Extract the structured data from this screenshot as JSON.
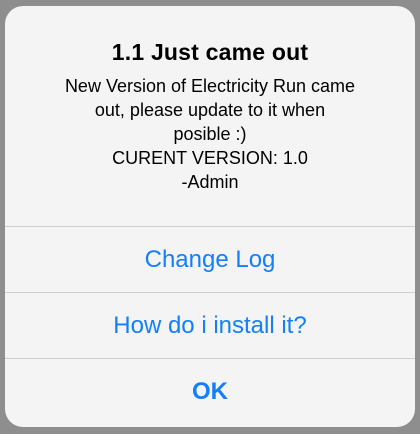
{
  "alert": {
    "title": "1.1 Just came out",
    "message": "New Version of Electricity Run came\nout,  please update to it when\nposible :)\nCURENT VERSION: 1.0\n-Admin",
    "buttons": {
      "change_log": "Change Log",
      "how_install": "How do i install it?",
      "ok": "OK"
    },
    "accent_color": "#147efb"
  }
}
